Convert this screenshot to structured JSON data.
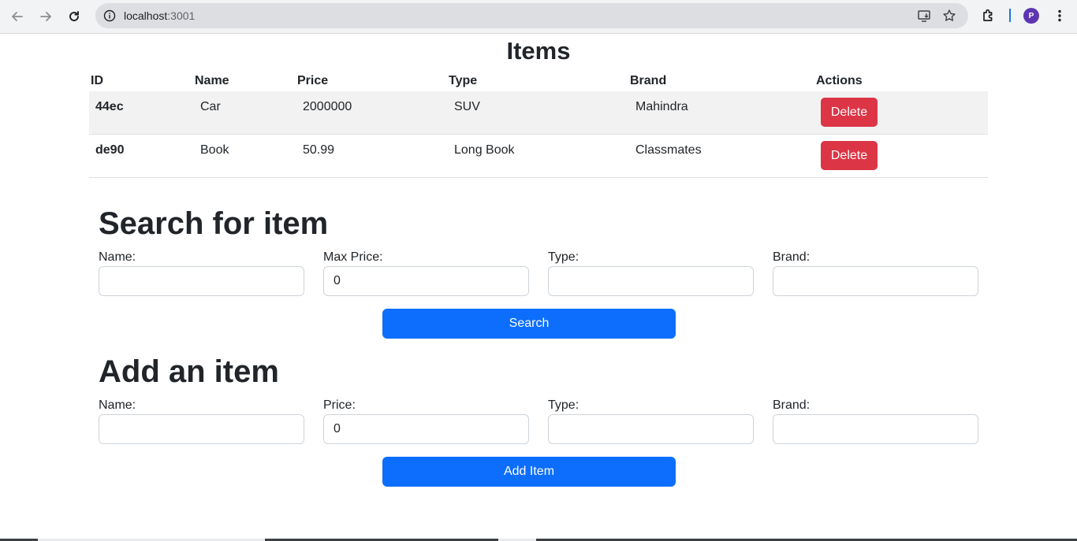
{
  "browser": {
    "url_host": "localhost",
    "url_port": ":3001",
    "profile_initial": "P"
  },
  "items_table": {
    "title": "Items",
    "headers": [
      "ID",
      "Name",
      "Price",
      "Type",
      "Brand",
      "Actions"
    ],
    "rows": [
      {
        "id": "44ec",
        "name": "Car",
        "price": "2000000",
        "type": "SUV",
        "brand": "Mahindra",
        "action": "Delete"
      },
      {
        "id": "de90",
        "name": "Book",
        "price": "50.99",
        "type": "Long Book",
        "brand": "Classmates",
        "action": "Delete"
      }
    ]
  },
  "search": {
    "title": "Search for item",
    "name_label": "Name:",
    "name_value": "",
    "price_label": "Max Price:",
    "price_value": "0",
    "type_label": "Type:",
    "type_value": "",
    "brand_label": "Brand:",
    "brand_value": "",
    "button_label": "Search"
  },
  "add": {
    "title": "Add an item",
    "name_label": "Name:",
    "name_value": "",
    "price_label": "Price:",
    "price_value": "0",
    "type_label": "Type:",
    "type_value": "",
    "brand_label": "Brand:",
    "brand_value": "",
    "button_label": "Add Item"
  },
  "colors": {
    "primary": "#0d6efd",
    "danger": "#dc3545",
    "stripe": "#f2f2f2"
  }
}
